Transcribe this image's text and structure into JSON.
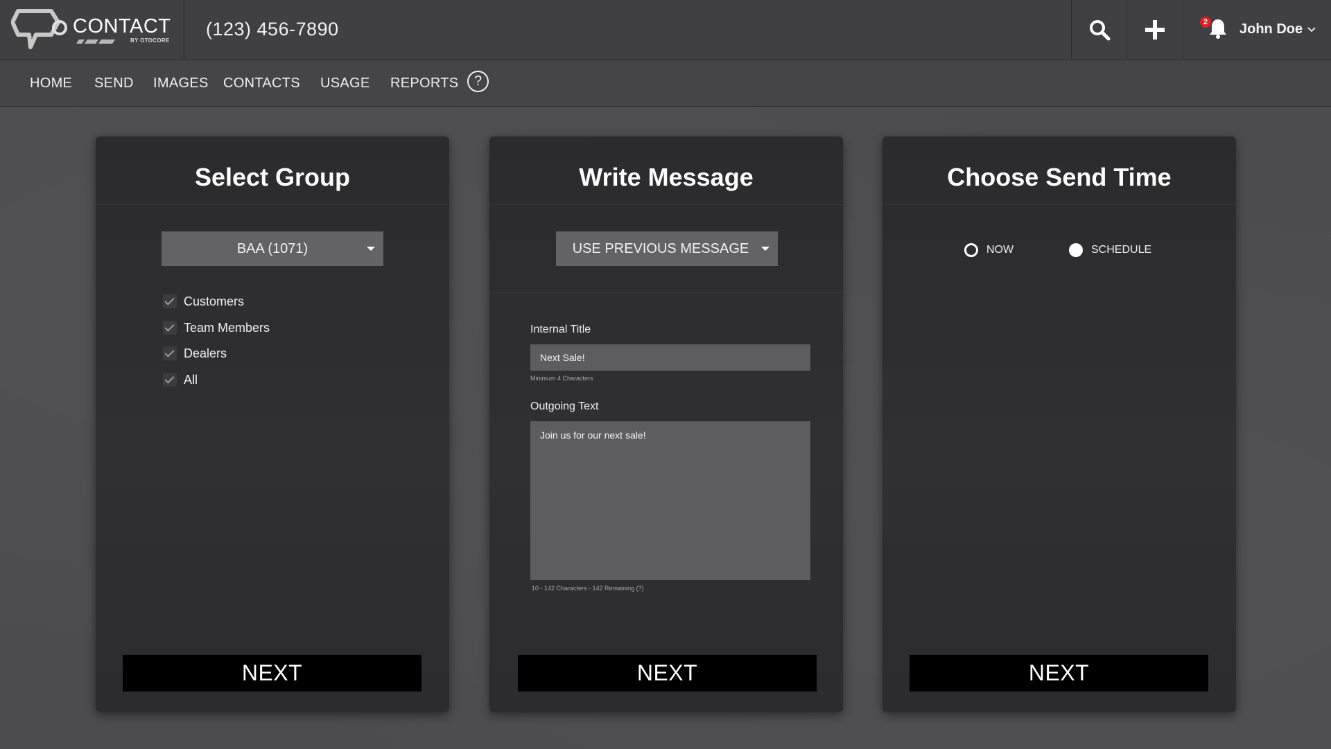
{
  "header": {
    "logo_text": "CONTACT",
    "logo_sub": "BY OTOCORE",
    "phone": "(123) 456-7890",
    "search_icon": "search-icon",
    "add_icon": "plus-icon",
    "notifications": {
      "icon": "bell-icon",
      "count": "2"
    },
    "user_name": "John Doe"
  },
  "nav": {
    "items": [
      "HOME",
      "SEND",
      "IMAGES",
      "CONTACTS",
      "USAGE",
      "REPORTS"
    ],
    "help": "?"
  },
  "cards": {
    "group": {
      "title": "Select Group",
      "dropdown": "BAA (1071)",
      "options": [
        "Customers",
        "Team Members",
        "Dealers",
        "All"
      ],
      "next": "NEXT"
    },
    "message": {
      "title": "Write Message",
      "dropdown": "USE PREVIOUS MESSAGE",
      "internal_title_label": "Internal Title",
      "internal_title_value": "Next Sale!",
      "internal_title_hint": "Minimum 4 Characters",
      "outgoing_label": "Outgoing Text",
      "outgoing_value": "Join us for our next sale!",
      "outgoing_hint": "10 - 142 Characters  -  142 Remaining (?)",
      "next": "NEXT"
    },
    "time": {
      "title": "Choose Send Time",
      "options": [
        "NOW",
        "SCHEDULE"
      ],
      "selected": "SCHEDULE",
      "next": "NEXT"
    }
  },
  "colors": {
    "background": "#4c4c4e",
    "topbar": "#404042",
    "card": "#2e2e30",
    "button": "#000000",
    "badge": "#e02020"
  }
}
